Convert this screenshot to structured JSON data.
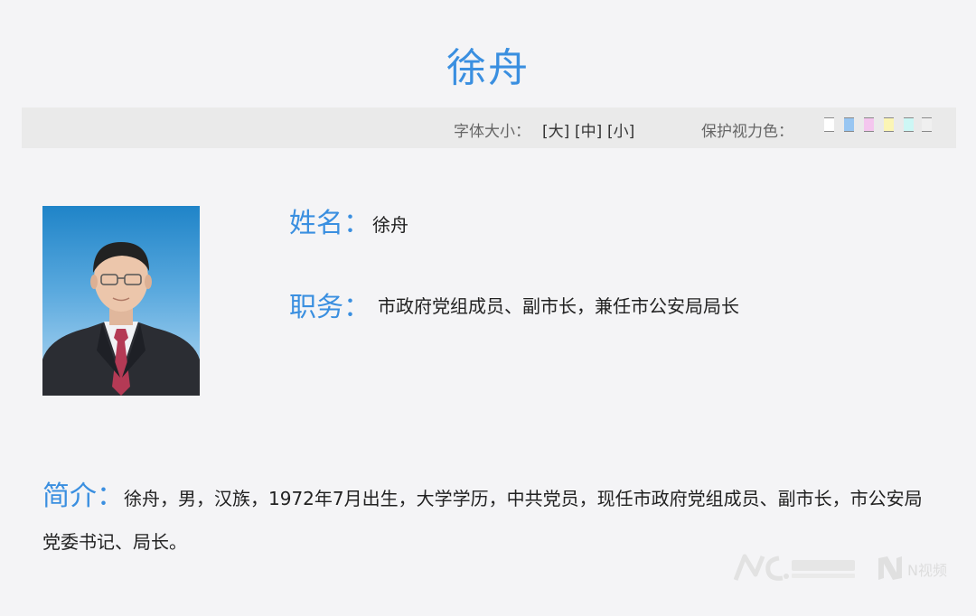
{
  "page": {
    "title": "徐舟"
  },
  "toolbar": {
    "font_size_label": "字体大小：",
    "size_big": "[大]",
    "size_medium": "[中]",
    "size_small": "[小]",
    "eye_color_label": "保护视力色：",
    "swatches": [
      "#ffffff",
      "#98c6f2",
      "#f4c6ee",
      "#fbf5b5",
      "#cdf7f5",
      "#f0f0f0"
    ]
  },
  "profile": {
    "name_label": "姓名：",
    "name_value": "徐舟",
    "position_label": "职务：",
    "position_value": "市政府党组成员、副市长，兼任市公安局局长"
  },
  "intro": {
    "label": "简介：",
    "text": "徐舟，男，汉族，1972年7月出生，大学学历，中共党员，现任市政府党组成员、副市长，市公安局党委书记、局长。"
  },
  "watermark": {
    "video_label": "N视频"
  }
}
